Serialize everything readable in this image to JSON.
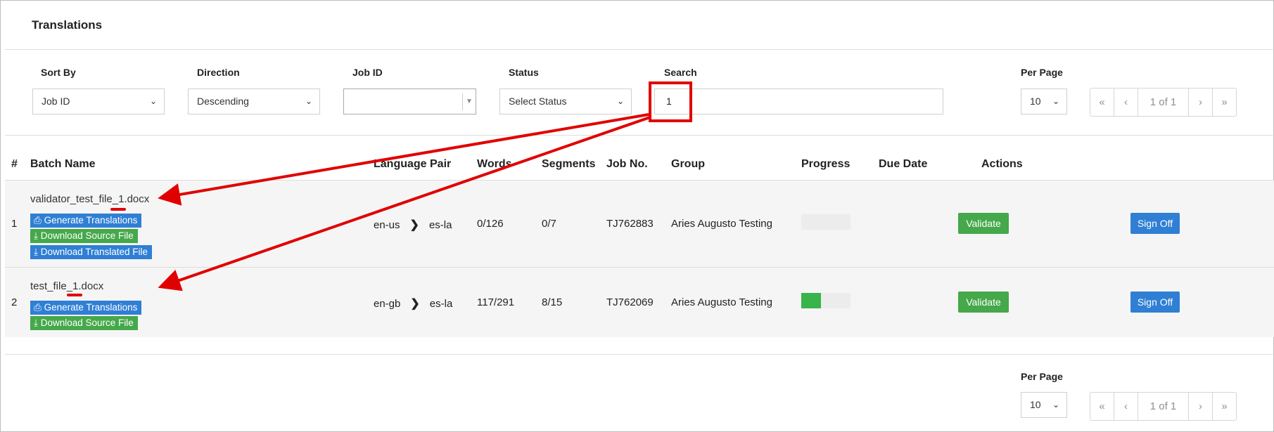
{
  "page": {
    "title": "Translations"
  },
  "filters": {
    "sort_by": {
      "label": "Sort By",
      "value": "Job ID"
    },
    "direction": {
      "label": "Direction",
      "value": "Descending"
    },
    "job_id": {
      "label": "Job ID",
      "value": ""
    },
    "status": {
      "label": "Status",
      "value": "Select Status"
    },
    "search": {
      "label": "Search",
      "value": "1"
    },
    "per_page": {
      "label": "Per Page",
      "value": "10"
    }
  },
  "pagination": {
    "first": "«",
    "prev": "‹",
    "page_info": "1 of 1",
    "next": "›",
    "last": "»"
  },
  "table": {
    "headers": [
      "#",
      "Batch Name",
      "Language Pair",
      "Words",
      "Segments",
      "Job No.",
      "Group",
      "Progress",
      "Due Date",
      "Actions"
    ],
    "rows": [
      {
        "index": "1",
        "batch_name": "validator_test_file_1.docx",
        "buttons": [
          "Generate Translations",
          "Download Source File",
          "Download Translated File"
        ],
        "source_lang": "en-us",
        "target_lang": "es-la",
        "words": "0/126",
        "segments": "0/7",
        "job_no": "TJ762883",
        "group": "Aries Augusto Testing",
        "progress": 0,
        "due_date": "",
        "validate": "Validate",
        "sign_off": "Sign Off"
      },
      {
        "index": "2",
        "batch_name": "test_file_1.docx",
        "buttons": [
          "Generate Translations",
          "Download Source File"
        ],
        "source_lang": "en-gb",
        "target_lang": "es-la",
        "words": "117/291",
        "segments": "8/15",
        "job_no": "TJ762069",
        "group": "Aries Augusto Testing",
        "progress": 0.4,
        "due_date": "",
        "validate": "Validate",
        "sign_off": "Sign Off"
      }
    ]
  },
  "footer": {
    "per_page_label": "Per Page",
    "per_page_value": "10"
  },
  "colors": {
    "primary_blue": "#2f7fd4",
    "success_green": "#45a84a",
    "annotation_red": "#e10000"
  }
}
